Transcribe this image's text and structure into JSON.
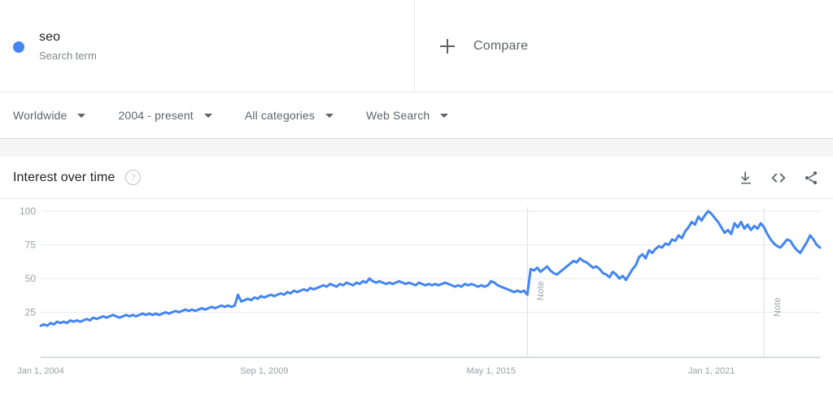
{
  "header": {
    "term": {
      "name": "seo",
      "type_label": "Search term",
      "dot_color": "#4285F4"
    },
    "compare": {
      "label": "Compare",
      "icon": "plus-icon"
    }
  },
  "filters": [
    {
      "label": "Worldwide",
      "icon": "chevron-down-icon"
    },
    {
      "label": "2004 - present",
      "icon": "chevron-down-icon"
    },
    {
      "label": "All categories",
      "icon": "chevron-down-icon"
    },
    {
      "label": "Web Search",
      "icon": "chevron-down-icon"
    }
  ],
  "card": {
    "title": "Interest over time",
    "help_icon": "help-icon",
    "help_glyph": "?",
    "actions": [
      {
        "name": "download-icon",
        "title": "Download"
      },
      {
        "name": "embed-icon",
        "title": "Embed"
      },
      {
        "name": "share-icon",
        "title": "Share"
      }
    ]
  },
  "chart_data": {
    "type": "line",
    "title": "Interest over time",
    "xlabel": "",
    "ylabel": "",
    "ylim": [
      0,
      100
    ],
    "yticks": [
      25,
      50,
      75,
      100
    ],
    "ytick_labels": [
      "25",
      "50",
      "75",
      "100"
    ],
    "grid": true,
    "legend": "none",
    "line_color": "#4285F4",
    "x_axis_range": [
      "Jan 1, 2004",
      "Oct 1, 2023"
    ],
    "xtick_labels": [
      "Jan 1, 2004",
      "Sep 1, 2009",
      "May 1, 2015",
      "Jan 1, 2021"
    ],
    "xtick_positions": [
      0,
      68,
      137,
      204
    ],
    "annotations": [
      {
        "label": "Note",
        "index": 148
      },
      {
        "label": "Note",
        "index": 220
      }
    ],
    "series": [
      {
        "name": "seo",
        "values": [
          15,
          16,
          15,
          17,
          16,
          18,
          17,
          18,
          17,
          19,
          18,
          19,
          18,
          19,
          20,
          19,
          21,
          20,
          21,
          22,
          21,
          22,
          23,
          22,
          21,
          22,
          23,
          22,
          23,
          22,
          23,
          24,
          23,
          24,
          23,
          24,
          23,
          24,
          25,
          24,
          25,
          26,
          25,
          26,
          27,
          26,
          27,
          26,
          27,
          28,
          27,
          28,
          29,
          28,
          29,
          30,
          29,
          30,
          29,
          30,
          38,
          33,
          34,
          35,
          34,
          36,
          35,
          37,
          36,
          37,
          38,
          37,
          38,
          39,
          38,
          40,
          39,
          41,
          40,
          41,
          42,
          41,
          43,
          42,
          43,
          44,
          45,
          44,
          46,
          45,
          44,
          46,
          45,
          47,
          46,
          45,
          47,
          46,
          48,
          47,
          50,
          48,
          47,
          48,
          47,
          46,
          47,
          46,
          47,
          48,
          47,
          46,
          47,
          46,
          45,
          47,
          46,
          45,
          46,
          45,
          46,
          45,
          46,
          47,
          46,
          45,
          44,
          45,
          44,
          46,
          45,
          46,
          45,
          44,
          45,
          44,
          45,
          48,
          47,
          45,
          44,
          43,
          42,
          41,
          40,
          41,
          40,
          41,
          38,
          57,
          56,
          58,
          55,
          57,
          59,
          56,
          54,
          53,
          55,
          57,
          59,
          61,
          63,
          62,
          65,
          63,
          62,
          60,
          58,
          59,
          57,
          54,
          53,
          51,
          55,
          53,
          50,
          52,
          49,
          53,
          57,
          60,
          66,
          68,
          65,
          71,
          69,
          72,
          74,
          73,
          76,
          75,
          79,
          78,
          82,
          80,
          85,
          88,
          92,
          90,
          96,
          93,
          97,
          100,
          98,
          95,
          92,
          88,
          84,
          86,
          83,
          91,
          88,
          92,
          87,
          90,
          86,
          89,
          87,
          91,
          88,
          83,
          79,
          76,
          74,
          73,
          76,
          79,
          78,
          74,
          71,
          69,
          73,
          77,
          82,
          79,
          75,
          73
        ]
      }
    ]
  }
}
